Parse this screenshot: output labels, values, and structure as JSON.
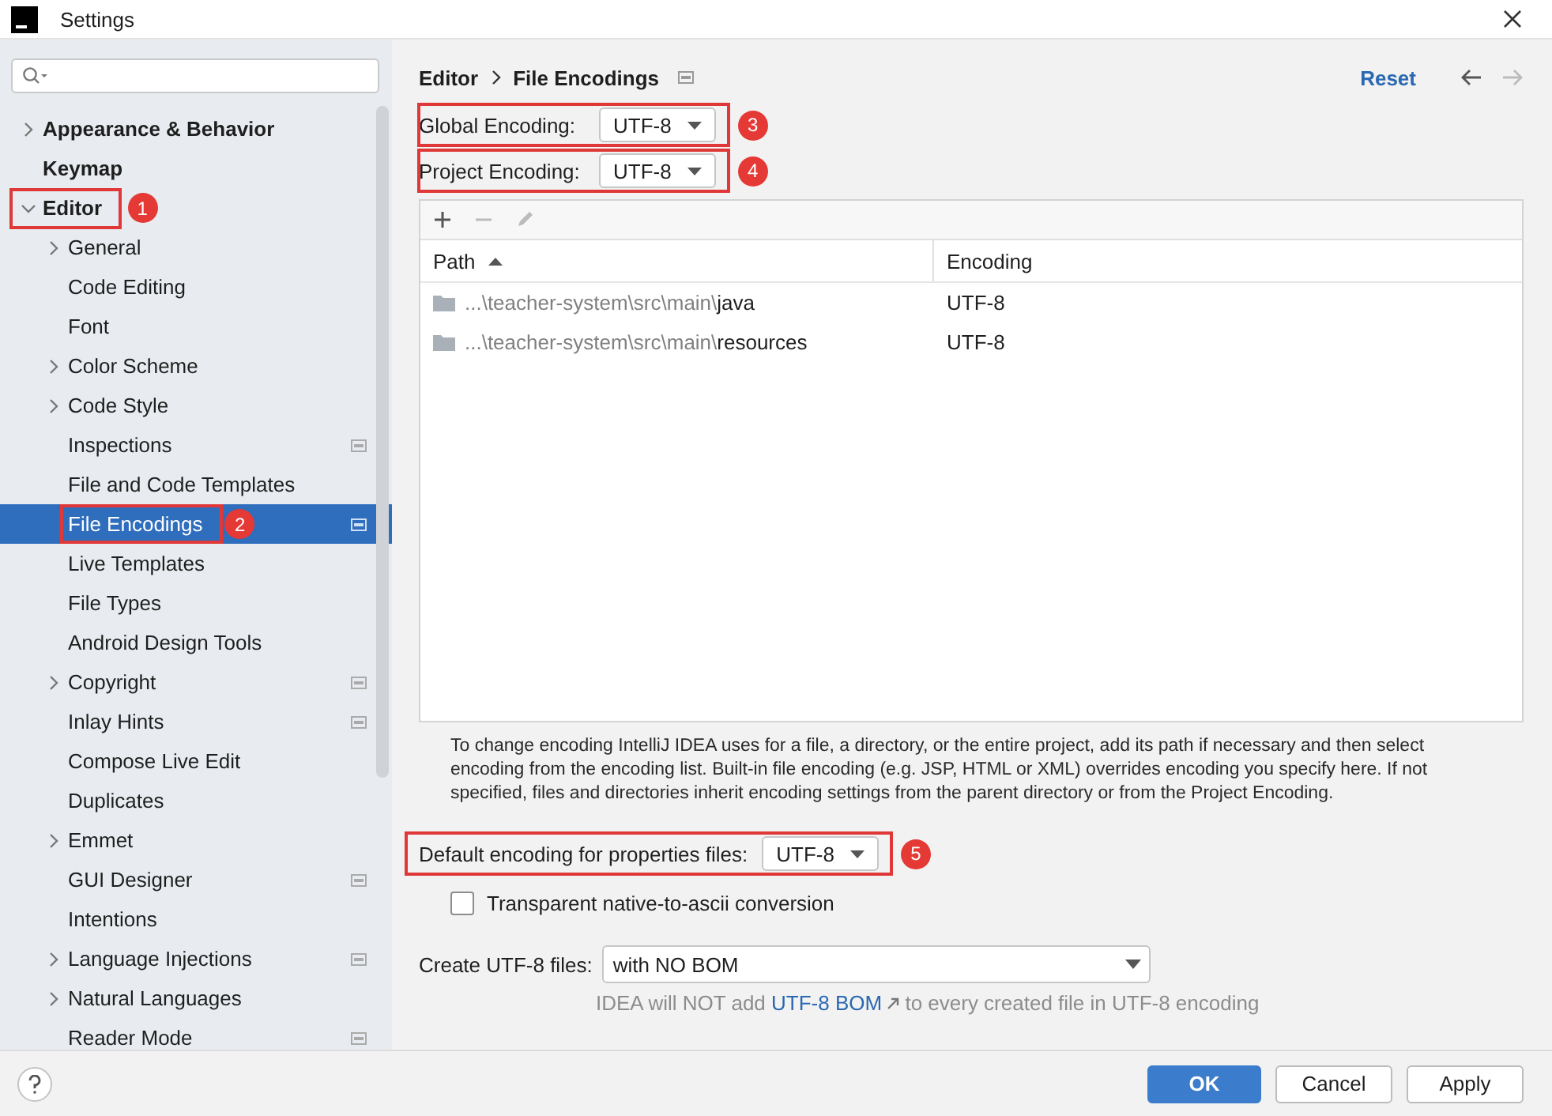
{
  "window": {
    "title": "Settings"
  },
  "sidebar": {
    "items": [
      {
        "label": "Appearance & Behavior",
        "kind": "collapsed",
        "selected": false,
        "project_scope": false
      },
      {
        "label": "Keymap",
        "kind": "leaf",
        "selected": false,
        "project_scope": false
      },
      {
        "label": "Editor",
        "kind": "expanded",
        "selected": false,
        "project_scope": false,
        "callout": "1",
        "children": [
          {
            "label": "General",
            "kind": "collapsed",
            "selected": false,
            "project_scope": false
          },
          {
            "label": "Code Editing",
            "kind": "leaf",
            "selected": false,
            "project_scope": false
          },
          {
            "label": "Font",
            "kind": "leaf",
            "selected": false,
            "project_scope": false
          },
          {
            "label": "Color Scheme",
            "kind": "collapsed",
            "selected": false,
            "project_scope": false
          },
          {
            "label": "Code Style",
            "kind": "collapsed",
            "selected": false,
            "project_scope": false
          },
          {
            "label": "Inspections",
            "kind": "leaf",
            "selected": false,
            "project_scope": true
          },
          {
            "label": "File and Code Templates",
            "kind": "leaf",
            "selected": false,
            "project_scope": false
          },
          {
            "label": "File Encodings",
            "kind": "leaf",
            "selected": true,
            "project_scope": true,
            "callout": "2"
          },
          {
            "label": "Live Templates",
            "kind": "leaf",
            "selected": false,
            "project_scope": false
          },
          {
            "label": "File Types",
            "kind": "leaf",
            "selected": false,
            "project_scope": false
          },
          {
            "label": "Android Design Tools",
            "kind": "leaf",
            "selected": false,
            "project_scope": false
          },
          {
            "label": "Copyright",
            "kind": "collapsed",
            "selected": false,
            "project_scope": true
          },
          {
            "label": "Inlay Hints",
            "kind": "leaf",
            "selected": false,
            "project_scope": true
          },
          {
            "label": "Compose Live Edit",
            "kind": "leaf",
            "selected": false,
            "project_scope": false
          },
          {
            "label": "Duplicates",
            "kind": "leaf",
            "selected": false,
            "project_scope": false
          },
          {
            "label": "Emmet",
            "kind": "collapsed",
            "selected": false,
            "project_scope": false
          },
          {
            "label": "GUI Designer",
            "kind": "leaf",
            "selected": false,
            "project_scope": true
          },
          {
            "label": "Intentions",
            "kind": "leaf",
            "selected": false,
            "project_scope": false
          },
          {
            "label": "Language Injections",
            "kind": "collapsed",
            "selected": false,
            "project_scope": true
          },
          {
            "label": "Natural Languages",
            "kind": "collapsed",
            "selected": false,
            "project_scope": false
          },
          {
            "label": "Reader Mode",
            "kind": "leaf",
            "selected": false,
            "project_scope": true
          }
        ]
      }
    ]
  },
  "main": {
    "breadcrumb": [
      "Editor",
      "File Encodings"
    ],
    "project_scope": true,
    "reset": "Reset",
    "back_disabled": false,
    "forward_disabled": true,
    "global_encoding": {
      "label": "Global Encoding:",
      "value": "UTF-8",
      "callout": "3"
    },
    "project_encoding": {
      "label": "Project Encoding:",
      "value": "UTF-8",
      "callout": "4"
    },
    "table": {
      "toolbar": [
        {
          "kind": "add",
          "disabled": false
        },
        {
          "kind": "remove",
          "disabled": true
        },
        {
          "kind": "edit",
          "disabled": true
        }
      ],
      "columns": [
        {
          "label": "Path",
          "sorted": true
        },
        {
          "label": "Encoding",
          "sorted": false
        }
      ],
      "rows": [
        {
          "path_prefix": "...\\teacher-system\\src\\main\\",
          "path_name": "java",
          "encoding": "UTF-8"
        },
        {
          "path_prefix": "...\\teacher-system\\src\\main\\",
          "path_name": "resources",
          "encoding": "UTF-8"
        }
      ]
    },
    "description": "To change encoding IntelliJ IDEA uses for a file, a directory, or the entire project, add its path if necessary and then select encoding from the encoding list. Built-in file encoding (e.g. JSP, HTML or XML) overrides encoding you specify here. If not specified, files and directories inherit encoding settings from the parent directory or from the Project Encoding.",
    "properties_encoding": {
      "label": "Default encoding for properties files:",
      "value": "UTF-8",
      "callout": "5"
    },
    "transparent_conversion": {
      "label": "Transparent native-to-ascii conversion",
      "checked": false
    },
    "create_utf8": {
      "label": "Create UTF-8 files:",
      "value": "with NO BOM"
    },
    "bom_hint": {
      "before": "IDEA will NOT add",
      "link": "UTF-8 BOM",
      "after": "to every created file in UTF-8 encoding"
    }
  },
  "buttons": [
    {
      "label": "OK",
      "kind": "primary"
    },
    {
      "label": "Cancel",
      "kind": "default"
    },
    {
      "label": "Apply",
      "kind": "default"
    }
  ]
}
